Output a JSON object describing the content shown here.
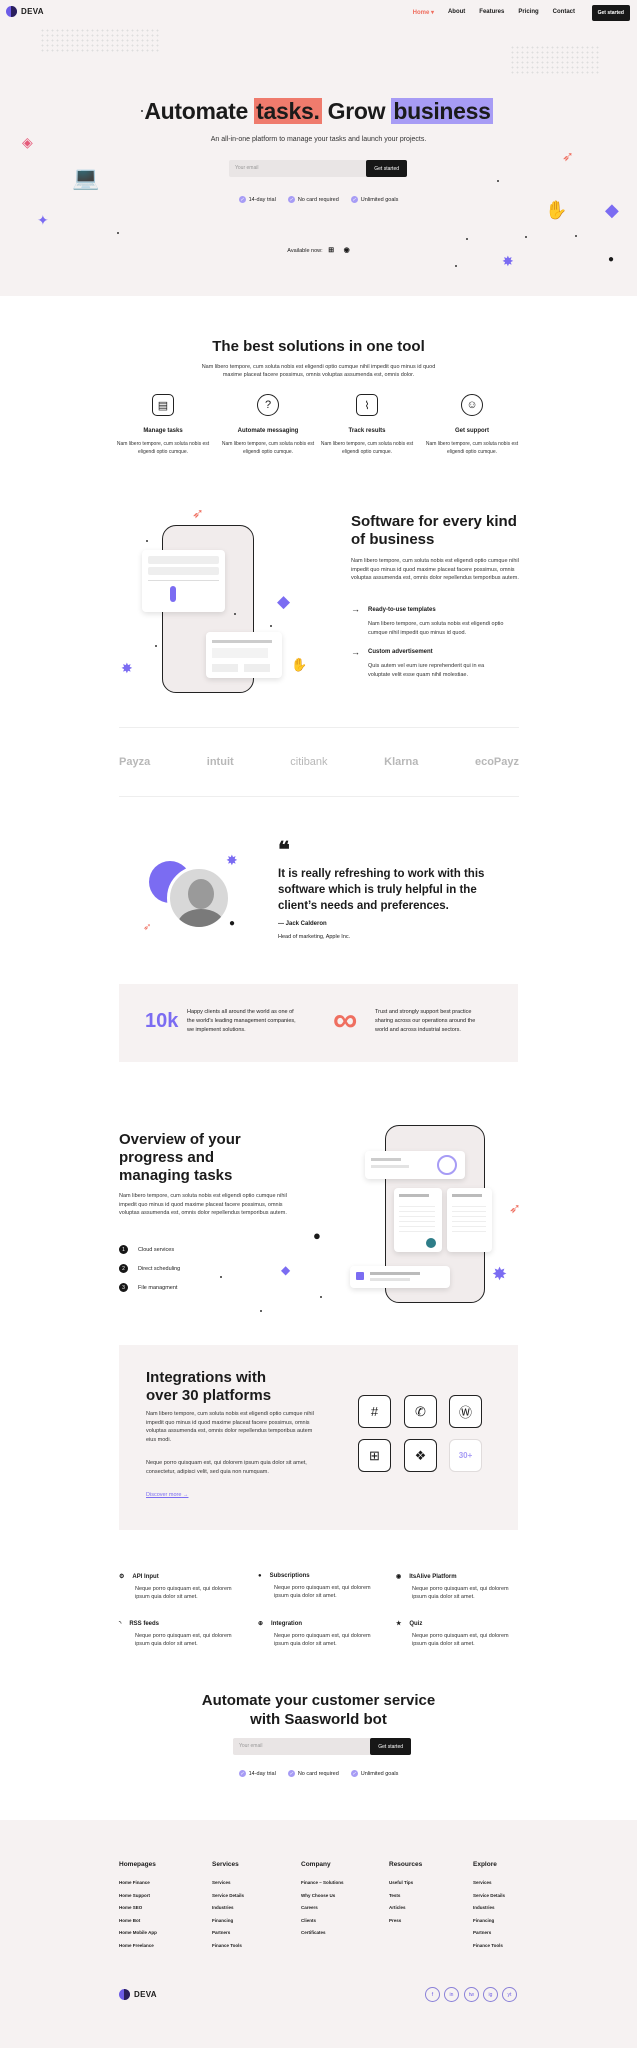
{
  "brand": "DEVA",
  "nav": {
    "links": [
      "Home",
      "About",
      "Features",
      "Pricing",
      "Contact"
    ],
    "cta": "Get started"
  },
  "hero": {
    "title_pre": "Automate",
    "title_hl1": "tasks.",
    "title_mid": "Grow",
    "title_hl2": "business",
    "subtitle": "An all-in-one platform to manage your tasks and launch your projects.",
    "email_placeholder": "Your email",
    "cta": "Get started",
    "checks": [
      "14-day trial",
      "No card required",
      "Unlimited goals"
    ],
    "available": "Available now:"
  },
  "solutions": {
    "title": "The best solutions in one tool",
    "text": "Nam libero tempore, cum soluta nobis est eligendi optio cumque nihil impedit quo minus id quod maxime placeat facere possimus, omnis voluptas assumenda est, omnis dolor.",
    "features": [
      {
        "icon": "folders-icon",
        "title": "Manage tasks",
        "desc": "Nam libero tempore, cum soluta nobis est eligendi optio cumque."
      },
      {
        "icon": "chat-icon",
        "title": "Automate messaging",
        "desc": "Nam libero tempore, cum soluta nobis est eligendi optio cumque."
      },
      {
        "icon": "chart-icon",
        "title": "Track results",
        "desc": "Nam libero tempore, cum soluta nobis est eligendi optio cumque."
      },
      {
        "icon": "support-icon",
        "title": "Get support",
        "desc": "Nam libero tempore, cum soluta nobis est eligendi optio cumque."
      }
    ]
  },
  "software": {
    "title": "Software for every kind of business",
    "text": "Nam libero tempore, cum soluta nobis est eligendi optio cumque nihil impedit quo minus id quod maxime placeat facere possimus, omnis voluptas assumenda est, omnis dolor repellendus temporibus autem.",
    "items": [
      {
        "title": "Ready-to-use templates",
        "desc": "Nam libero tempore, cum soluta nobis est eligendi optio cumque nihil impedit quo minus id quod."
      },
      {
        "title": "Custom advertisement",
        "desc": "Quis autem vel eum iure reprehenderit qui in ea voluptate velit esse quam nihil molestiae."
      }
    ]
  },
  "logos": [
    "Payza",
    "intuit",
    "citibank",
    "Klarna",
    "ecoPayz"
  ],
  "testimonial": {
    "quote": "It is really refreshing to work with this software which is truly helpful in the client’s needs and preferences.",
    "author": "— Jack Calderon",
    "role": "Head of marketing, Apple Inc."
  },
  "stats": [
    {
      "value": "10k",
      "text": "Happy clients all around the world as one of the world's leading management companies, we implement solutions."
    },
    {
      "value": "∞",
      "text": "Trust and strongly support best practice sharing across our operations around the world and across industrial sectors."
    }
  ],
  "overview": {
    "title": "Overview of your progress and managing tasks",
    "text": "Nam libero tempore, cum soluta nobis est eligendi optio cumque nihil impedit quo minus id quod maxime placeat facere possimus, omnis voluptas assumenda est, omnis dolor repellendus temporibus autem.",
    "list": [
      "Cloud services",
      "Direct scheduling",
      "File managment"
    ]
  },
  "integrations": {
    "title": "Integrations with over 30 platforms",
    "text1": "Nam libero tempore, cum soluta nobis est eligendi optio cumque nihil impedit quo minus id quod maxime placeat facere possimus, omnis voluptas assumenda est, omnis dolor repellendus temporibus autem eius modi.",
    "text2": "Neque porro quisquam est, qui dolorem ipsum quia dolor sit amet, consectetur, adipisci velit, sed quia non numquam.",
    "link": "Discover more",
    "tiles": [
      "slack-icon",
      "messenger-icon",
      "wordpress-icon",
      "windows-icon",
      "dropbox-icon"
    ],
    "more": "30+"
  },
  "grid": [
    {
      "icon": "gear-icon",
      "title": "API Input",
      "desc": "Neque porro quisquam est, qui dolorem ipsum quia dolor sit amet."
    },
    {
      "icon": "user-icon",
      "title": "Subscriptions",
      "desc": "Neque porro quisquam est, qui dolorem ipsum quia dolor sit amet."
    },
    {
      "icon": "github-icon",
      "title": "ItsAlive Platform",
      "desc": "Neque porro quisquam est, qui dolorem ipsum quia dolor sit amet."
    },
    {
      "icon": "rss-icon",
      "title": "RSS feeds",
      "desc": "Neque porro quisquam est, qui dolorem ipsum quia dolor sit amet."
    },
    {
      "icon": "plus-circle-icon",
      "title": "Integration",
      "desc": "Neque porro quisquam est, qui dolorem ipsum quia dolor sit amet."
    },
    {
      "icon": "star-icon",
      "title": "Quiz",
      "desc": "Neque porro quisquam est, qui dolorem ipsum quia dolor sit amet."
    }
  ],
  "cta": {
    "title_line1": "Automate your customer service",
    "title_line2": "with Saasworld bot",
    "email_placeholder": "Your email",
    "button": "Get started",
    "checks": [
      "14-day trial",
      "No card required",
      "Unlimited goals"
    ]
  },
  "footer": {
    "columns": [
      {
        "title": "Homepages",
        "items": [
          "Home Finance",
          "Home Support",
          "Home SEO",
          "Home Bot",
          "Home Mobile App",
          "Home Freelance"
        ]
      },
      {
        "title": "Services",
        "items": [
          "Services",
          "Service Details",
          "Industries",
          "Financing",
          "Partners",
          "Finance Tools"
        ]
      },
      {
        "title": "Company",
        "items": [
          "Finance – Solutions",
          "Why Choose Us",
          "Careers",
          "Clients",
          "Certificates"
        ]
      },
      {
        "title": "Resources",
        "items": [
          "Useful Tips",
          "Tests",
          "Articles",
          "Press"
        ]
      },
      {
        "title": "Explore",
        "items": [
          "Services",
          "Service Details",
          "Industries",
          "Financing",
          "Partners",
          "Finance Tools"
        ]
      }
    ],
    "social": [
      "f",
      "in",
      "tw",
      "ig",
      "yt"
    ]
  },
  "colors": {
    "accent_red": "#ef7b6d",
    "accent_purple": "#a79cf5",
    "dark": "#171717",
    "bg": "#f6f2f2"
  }
}
